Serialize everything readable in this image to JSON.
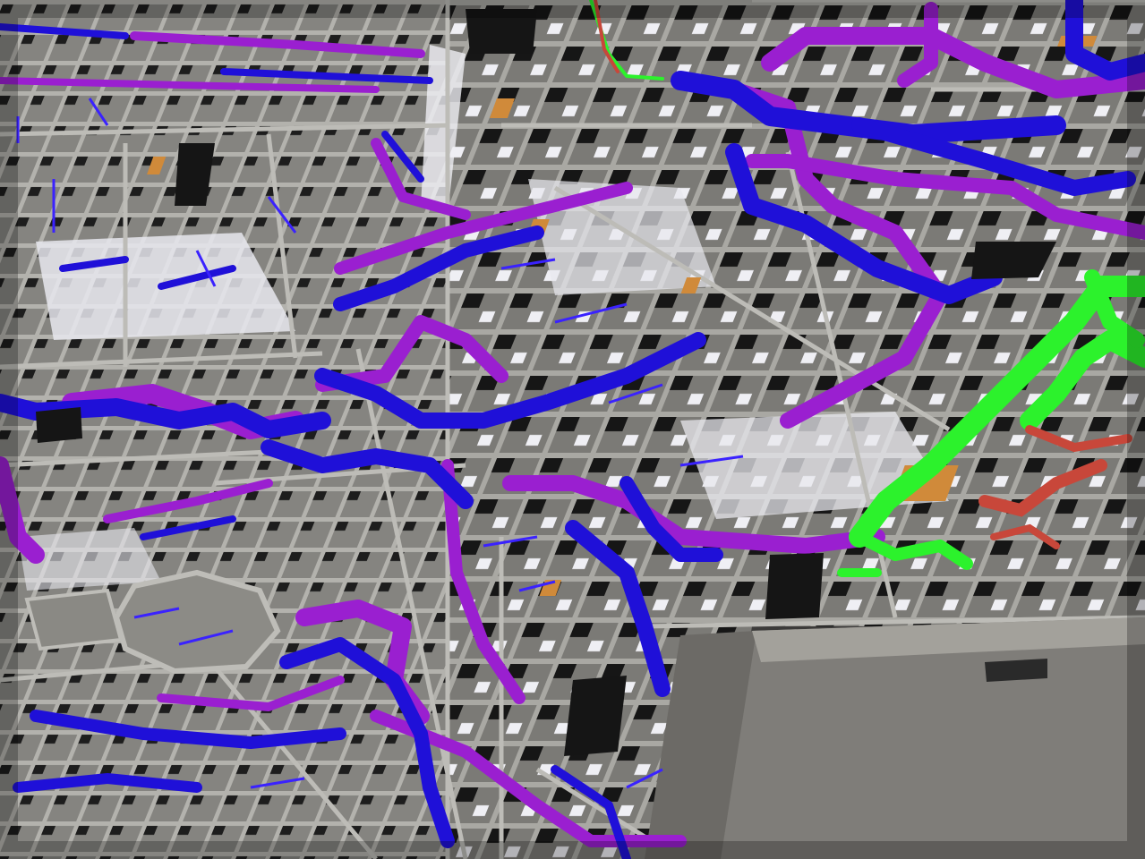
{
  "scene": {
    "colors": {
      "background": "#3c3b3a",
      "wall_top": "#9c9b96",
      "wall_shadow": "#1a1a1a",
      "floor": "#7d7c78",
      "floor_light": "#e9e9ef",
      "supply_duct": "#1f10d8",
      "return_duct": "#9a1fd0",
      "green_duct": "#2cf22c",
      "red_pipe": "#c8473a",
      "stairs": "#d08a3a",
      "roof_slab": "#7f7d79"
    }
  }
}
